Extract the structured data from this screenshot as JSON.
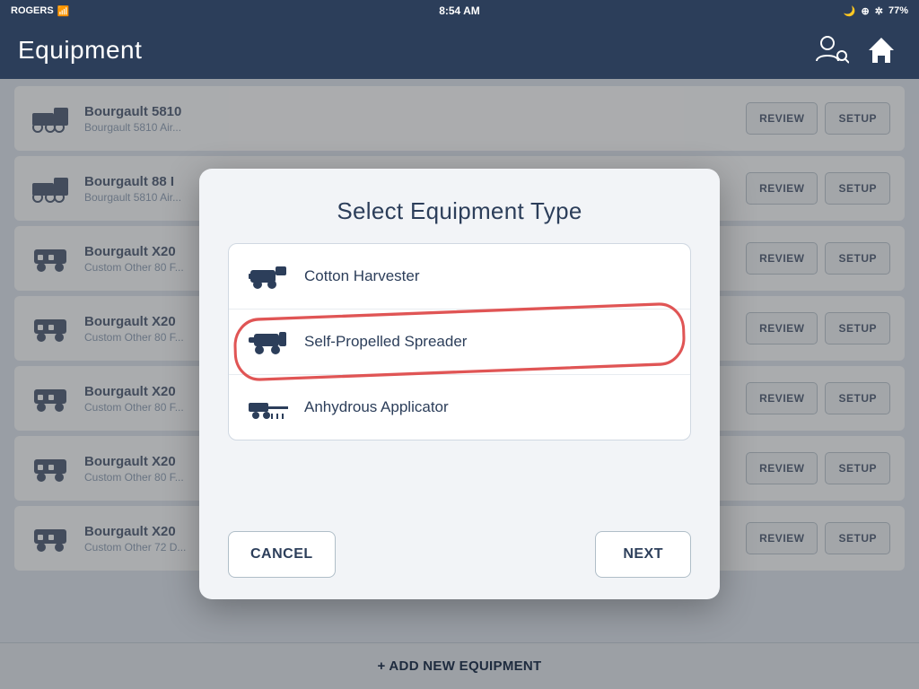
{
  "statusBar": {
    "carrier": "ROGERS",
    "time": "8:54 AM",
    "battery": "77%",
    "icons": [
      "wifi",
      "moon",
      "location",
      "bluetooth",
      "battery"
    ]
  },
  "header": {
    "title": "Equipment",
    "userIconLabel": "user-icon",
    "homeIconLabel": "home-icon"
  },
  "equipmentList": {
    "items": [
      {
        "name": "Bourgault 5810",
        "sub": "Bourgault 5810 Air...",
        "icon": "seeder"
      },
      {
        "name": "Bourgault 88 I",
        "sub": "Bourgault 5810 Air...",
        "icon": "seeder"
      },
      {
        "name": "Bourgault X20",
        "sub": "Custom Other 80 F...",
        "icon": "cart"
      },
      {
        "name": "Bourgault X20",
        "sub": "Custom Other 80 F...",
        "icon": "cart"
      },
      {
        "name": "Bourgault X20",
        "sub": "Custom Other 80 F...",
        "icon": "cart"
      },
      {
        "name": "Bourgault X20",
        "sub": "Custom Other 80 F...",
        "icon": "cart"
      },
      {
        "name": "Bourgault X20",
        "sub": "Custom Other 72 D...",
        "icon": "cart"
      }
    ],
    "reviewLabel": "REVIEW",
    "setupLabel": "SETUP"
  },
  "addEquipment": {
    "label": "+ ADD NEW EQUIPMENT"
  },
  "modal": {
    "title": "Select Equipment Type",
    "equipmentTypes": [
      {
        "id": "cotton-harvester",
        "label": "Cotton Harvester",
        "icon": "cotton"
      },
      {
        "id": "self-propelled-spreader",
        "label": "Self-Propelled Spreader",
        "icon": "spreader",
        "highlighted": true
      },
      {
        "id": "anhydrous-applicator",
        "label": "Anhydrous Applicator",
        "icon": "anhydrous"
      }
    ],
    "cancelLabel": "CANCEL",
    "nextLabel": "NEXT"
  }
}
